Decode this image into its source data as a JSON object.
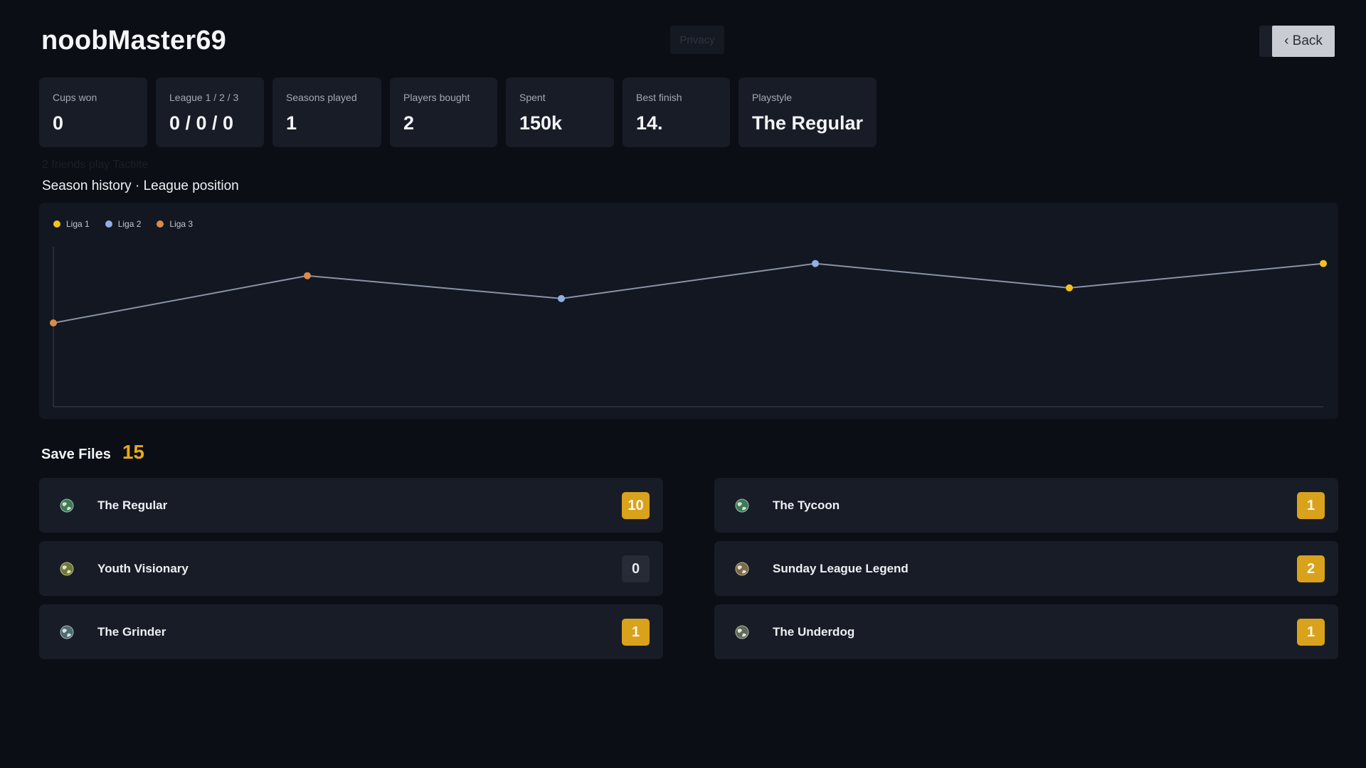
{
  "header": {
    "player_name": "noobMaster69",
    "back_label": "‹ Back",
    "ghost_privacy": "Privacy"
  },
  "stats": [
    {
      "label": "Cups won",
      "value": "0"
    },
    {
      "label": "League 1 / 2 / 3",
      "value": "0 / 0 / 0"
    },
    {
      "label": "Seasons played",
      "value": "1"
    },
    {
      "label": "Players bought",
      "value": "2"
    },
    {
      "label": "Spent",
      "value": "150k"
    },
    {
      "label": "Best finish",
      "value": "14."
    },
    {
      "label": "Playstyle",
      "value": "The Regular"
    }
  ],
  "ghost": {
    "friends_text": "2 friends play Tactiite"
  },
  "season_history": {
    "title": "Season history · League position"
  },
  "chart_data": {
    "type": "line",
    "legend_position": "top-left",
    "grid": false,
    "legend": [
      {
        "name": "Liga 1",
        "color": "#f4c21c"
      },
      {
        "name": "Liga 2",
        "color": "#93aee2"
      },
      {
        "name": "Liga 3",
        "color": "#d98b4a"
      }
    ],
    "line_color": "#8a93a6",
    "points": [
      {
        "x": 0,
        "y": 0.55,
        "league": "Liga 3"
      },
      {
        "x": 1,
        "y": 0.86,
        "league": "Liga 3"
      },
      {
        "x": 2,
        "y": 0.71,
        "league": "Liga 2"
      },
      {
        "x": 3,
        "y": 0.94,
        "league": "Liga 2"
      },
      {
        "x": 4,
        "y": 0.78,
        "league": "Liga 1"
      },
      {
        "x": 5,
        "y": 0.94,
        "league": "Liga 1"
      }
    ],
    "xlim": [
      0,
      5
    ],
    "ylim": [
      0,
      1.05
    ]
  },
  "save_files": {
    "title": "Save Files",
    "count": "15",
    "items": [
      {
        "name": "The Regular",
        "count": "10",
        "active": true
      },
      {
        "name": "The Tycoon",
        "count": "1",
        "active": true
      },
      {
        "name": "Youth Visionary",
        "count": "0",
        "active": false
      },
      {
        "name": "Sunday League Legend",
        "count": "2",
        "active": true
      },
      {
        "name": "The Grinder",
        "count": "1",
        "active": true
      },
      {
        "name": "The Underdog",
        "count": "1",
        "active": true
      }
    ]
  }
}
